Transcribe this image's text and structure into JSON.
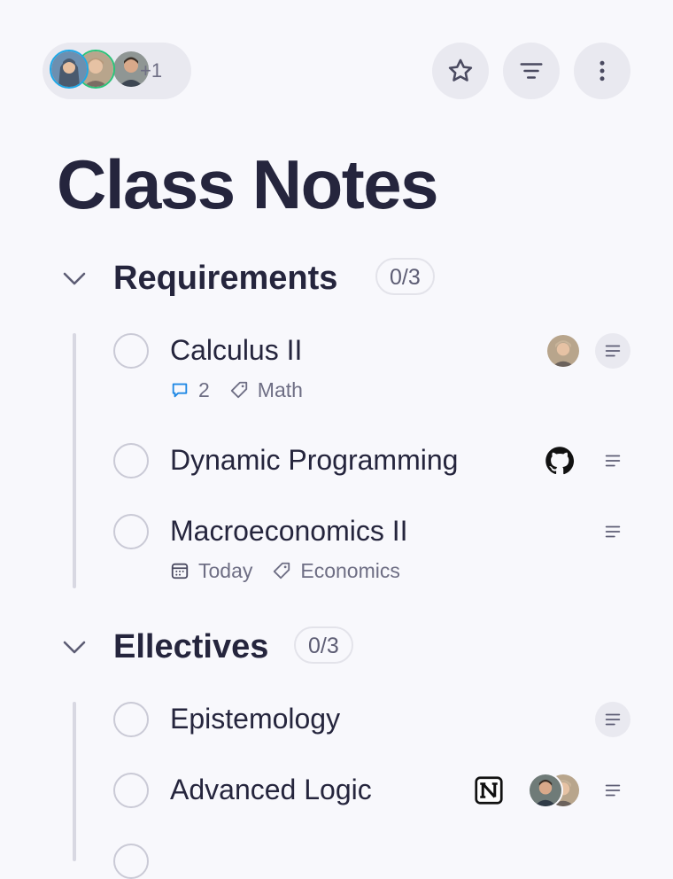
{
  "header": {
    "collaborators": [
      {
        "name": "avatar-1",
        "bg": "#6c8fb0",
        "skin": "#e8c0a0",
        "hair": "#4a5a6e",
        "ring": "#1ea7e6"
      },
      {
        "name": "avatar-2",
        "bg": "#b8a58c",
        "skin": "#e6c2a4",
        "hair": "#b89a7c",
        "ring": "#2bc37a"
      },
      {
        "name": "avatar-3",
        "bg": "#8f9694",
        "skin": "#d9a98a",
        "hair": "#3b3028",
        "ring": ""
      }
    ],
    "collaborator_overflow": "+1",
    "icons": [
      "star-icon",
      "filter-icon",
      "more-vertical-icon"
    ]
  },
  "page": {
    "title": "Class Notes"
  },
  "sections": [
    {
      "title": "Requirements",
      "count": "0/3",
      "tasks": [
        {
          "title": "Calculus II",
          "comments": "2",
          "tag": "Math",
          "due": "",
          "assignee": "person",
          "integration": "",
          "desc_filled": true
        },
        {
          "title": "Dynamic Programming",
          "comments": "",
          "tag": "",
          "due": "",
          "assignee": "",
          "integration": "github-icon",
          "desc_filled": false
        },
        {
          "title": "Macroeconomics II",
          "comments": "",
          "tag": "Economics",
          "due": "Today",
          "assignee": "",
          "integration": "",
          "desc_filled": false
        }
      ]
    },
    {
      "title": "Ellectives",
      "count": "0/3",
      "tasks": [
        {
          "title": "Epistemology",
          "comments": "",
          "tag": "",
          "due": "",
          "assignee": "",
          "integration": "",
          "desc_filled": true
        },
        {
          "title": "Advanced Logic",
          "comments": "",
          "tag": "",
          "due": "",
          "assignee": "two-people",
          "integration": "notion-icon",
          "desc_filled": false
        }
      ]
    }
  ],
  "colors": {
    "background": "#f8f8fc",
    "text": "#25253d",
    "muted": "#6e6e84",
    "comment_accent": "#1e88e5",
    "pill": "#e9e9f0"
  }
}
